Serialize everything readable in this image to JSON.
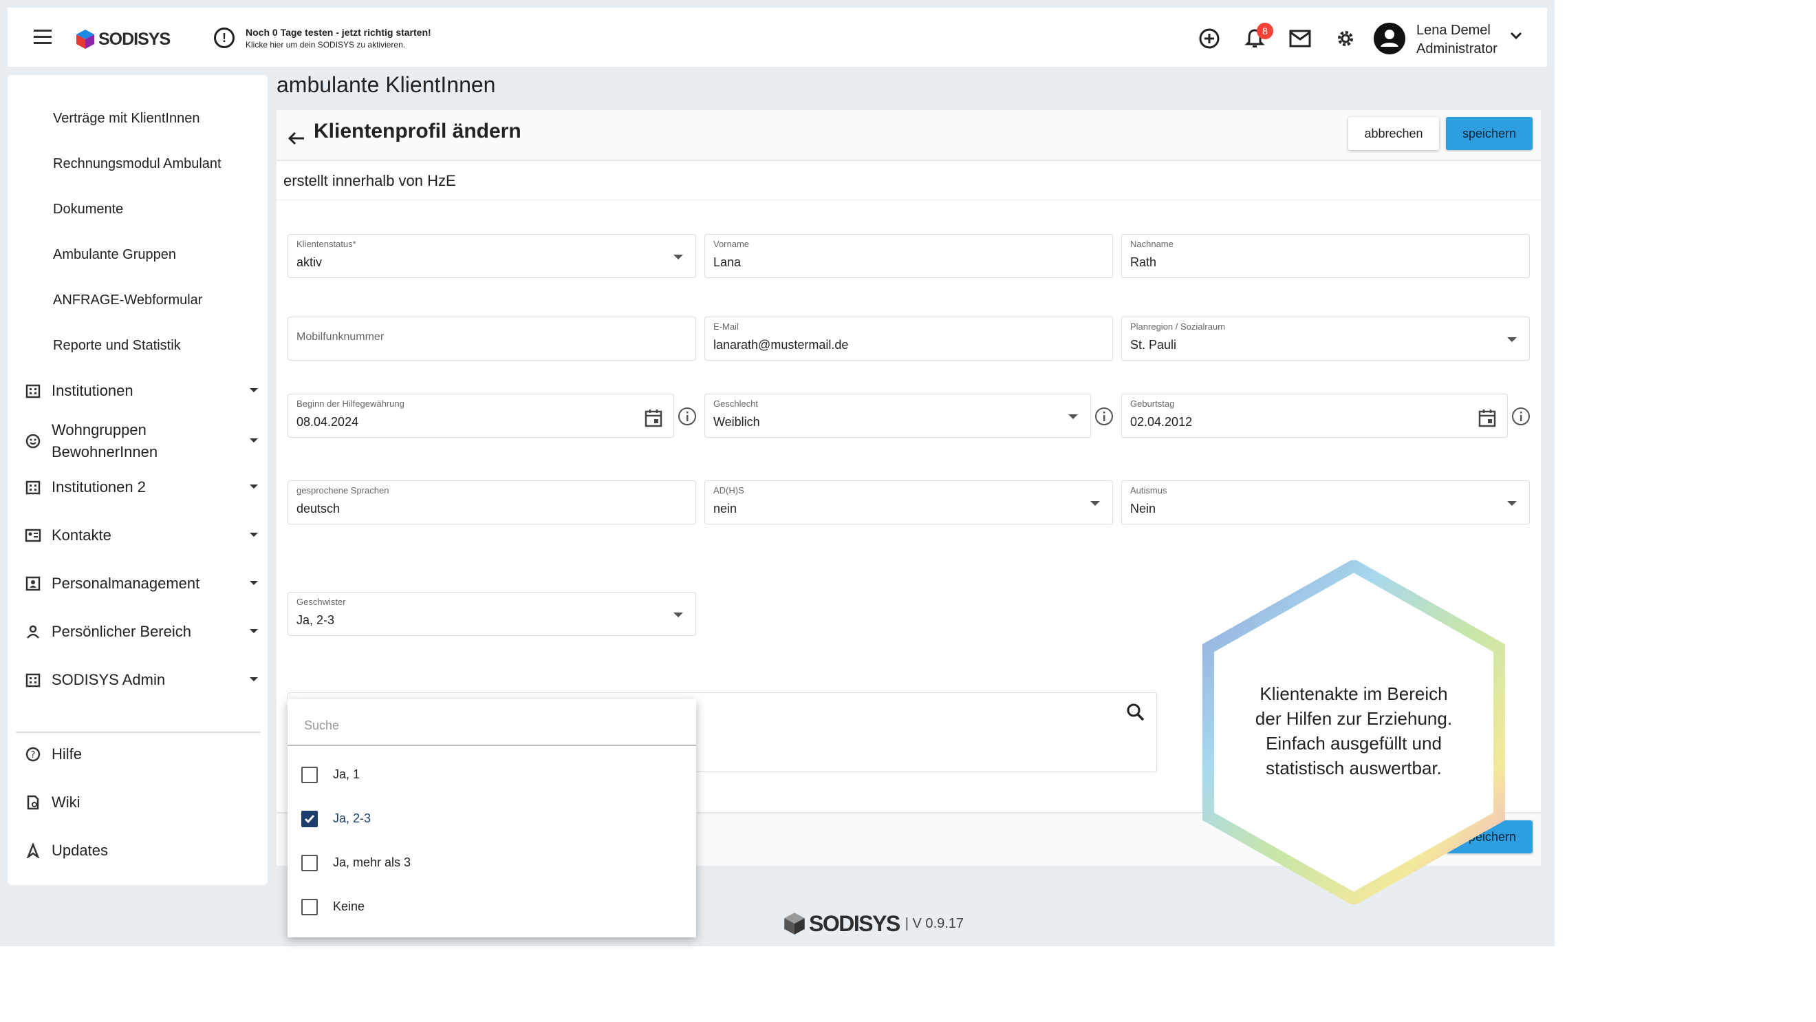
{
  "header": {
    "logo_text": "SODISYS",
    "trial_title": "Noch 0 Tage testen - jetzt richtig starten!",
    "trial_sub": "Klicke hier um dein SODISYS zu aktivieren.",
    "notification_count": "8",
    "user_name": "Lena Demel",
    "user_role": "Administrator"
  },
  "sidebar": {
    "sub_items": [
      "Verträge mit KlientInnen",
      "Rechnungsmodul Ambulant",
      "Dokumente",
      "Ambulante Gruppen",
      "ANFRAGE-Webformular",
      "Reporte und Statistik"
    ],
    "sections": [
      {
        "label": "Institutionen",
        "icon": "building-icon"
      },
      {
        "label": "Wohngruppen BewohnerInnen",
        "icon": "smiley-icon"
      },
      {
        "label": "Institutionen 2",
        "icon": "building-icon"
      },
      {
        "label": "Kontakte",
        "icon": "contact-card-icon"
      },
      {
        "label": "Personalmanagement",
        "icon": "id-badge-icon"
      },
      {
        "label": "Persönlicher Bereich",
        "icon": "person-icon"
      },
      {
        "label": "SODISYS Admin",
        "icon": "building-icon"
      }
    ],
    "bottom": [
      {
        "label": "Hilfe",
        "icon": "help-icon"
      },
      {
        "label": "Wiki",
        "icon": "wiki-icon"
      },
      {
        "label": "Updates",
        "icon": "updates-icon"
      }
    ]
  },
  "page": {
    "title": "ambulante KlientInnen",
    "card_title": "Klientenprofil ändern",
    "cancel_label": "abbrechen",
    "save_label": "speichern",
    "subtitle": "erstellt innerhalb von HzE"
  },
  "form": {
    "klientenstatus": {
      "label": "Klientenstatus*",
      "value": "aktiv"
    },
    "vorname": {
      "label": "Vorname",
      "value": "Lana"
    },
    "nachname": {
      "label": "Nachname",
      "value": "Rath"
    },
    "mobil": {
      "placeholder": "Mobilfunknummer"
    },
    "email": {
      "label": "E-Mail",
      "value": "lanarath@mustermail.de"
    },
    "planregion": {
      "label": "Planregion / Sozialraum",
      "value": "St. Pauli"
    },
    "beginn": {
      "label": "Beginn der Hilfegewährung",
      "value": "08.04.2024"
    },
    "geschlecht": {
      "label": "Geschlecht",
      "value": "Weiblich"
    },
    "geburtstag": {
      "label": "Geburtstag",
      "value": "02.04.2012"
    },
    "sprachen": {
      "label": "gesprochene Sprachen",
      "value": "deutsch"
    },
    "adhs": {
      "label": "AD(H)S",
      "value": "nein"
    },
    "autismus": {
      "label": "Autismus",
      "value": "Nein"
    },
    "geschwister": {
      "label": "Geschwister",
      "value": "Ja, 2-3"
    }
  },
  "dropdown": {
    "search_placeholder": "Suche",
    "options": [
      {
        "label": "Ja, 1",
        "checked": false
      },
      {
        "label": "Ja, 2-3",
        "checked": true
      },
      {
        "label": "Ja, mehr als 3",
        "checked": false
      },
      {
        "label": "Keine",
        "checked": false
      }
    ]
  },
  "promo": {
    "lines": [
      "Klientenakte im Bereich",
      "der Hilfen zur Erziehung.",
      "Einfach ausgefüllt und",
      "statistisch auswertbar."
    ]
  },
  "footer": {
    "logo_text": "SODISYS",
    "version": "| V 0.9.17"
  },
  "colors": {
    "primary": "#2d9ee0",
    "check": "#1a3d6b",
    "background": "#e7edf1",
    "badge": "#f44336"
  }
}
